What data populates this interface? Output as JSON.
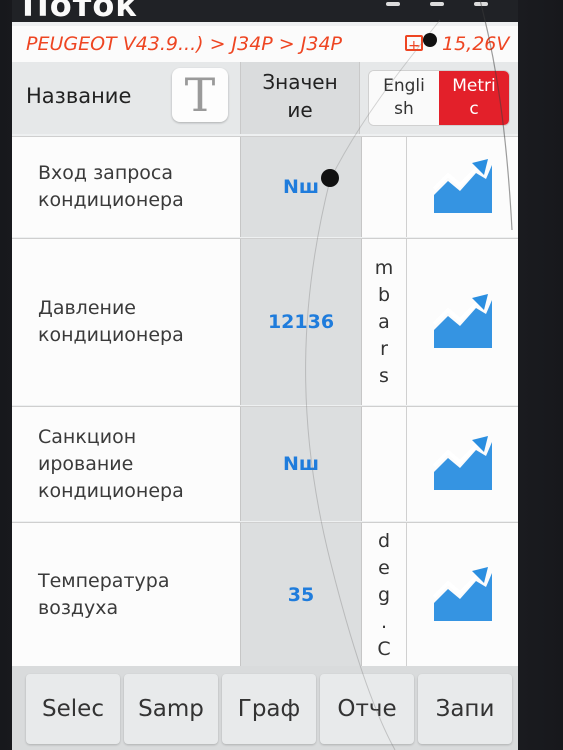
{
  "app": {
    "title": "Поток"
  },
  "breadcrumb": {
    "path": "PEUGEOT V43.9...) > J34P > J34P",
    "voltage": "15,26V"
  },
  "header": {
    "name_label": "Название",
    "font_icon": "T",
    "value_label": "Значен\nие",
    "units": {
      "english": "Engli\nsh",
      "metric": "Metri\nc",
      "active": "metric"
    }
  },
  "rows": [
    {
      "name": "Вход запроса\nкондиционера",
      "value": "Nш",
      "unit": ""
    },
    {
      "name": "Давление\nкондиционера",
      "value": "12136",
      "unit": "m\nb\na\nr\ns"
    },
    {
      "name": "Санкцион\nирование\nкондиционера",
      "value": "Nш",
      "unit": ""
    },
    {
      "name": "Температура\nвоздуха",
      "value": "35",
      "unit": "d\ne\ng\n.\nC"
    }
  ],
  "bottom": {
    "buttons": [
      "Selec",
      "Samp",
      "Граф",
      "Отче",
      "Запи"
    ]
  },
  "colors": {
    "accent": "#e3202a",
    "value": "#1f7cdc",
    "graph": "#2a8ee0",
    "breadcrumb": "#ee4522"
  },
  "icons": {
    "graph": "trend-chart-icon",
    "battery": "battery-icon"
  }
}
